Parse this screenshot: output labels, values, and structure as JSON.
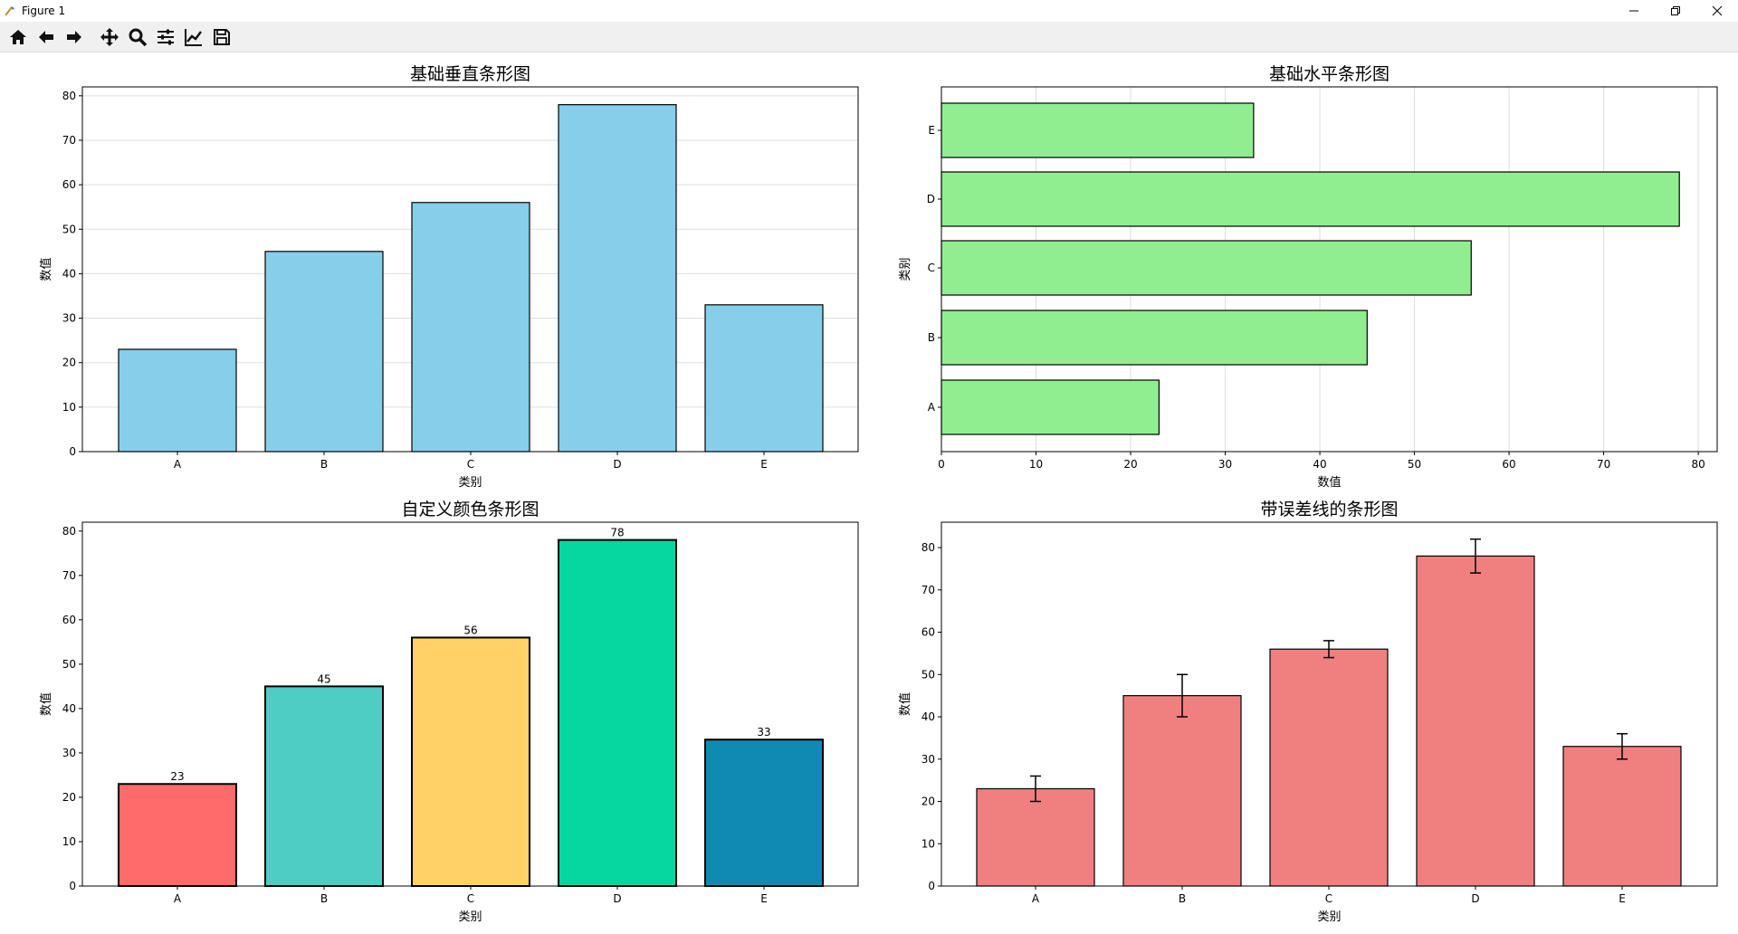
{
  "window": {
    "title": "Figure 1",
    "controls": [
      "minimize",
      "maximize",
      "close"
    ]
  },
  "toolbar": {
    "tools": [
      {
        "name": "home-button",
        "icon": "home-icon"
      },
      {
        "name": "back-button",
        "icon": "arrow-left-icon"
      },
      {
        "name": "forward-button",
        "icon": "arrow-right-icon"
      },
      {
        "name": "pan-button",
        "icon": "move-icon"
      },
      {
        "name": "zoom-button",
        "icon": "magnifier-icon"
      },
      {
        "name": "configure-subplots-button",
        "icon": "sliders-icon"
      },
      {
        "name": "edit-axis-button",
        "icon": "line-chart-icon"
      },
      {
        "name": "save-button",
        "icon": "floppy-disk-icon"
      }
    ]
  },
  "chart_data": [
    {
      "type": "bar",
      "orientation": "vertical",
      "title": "基础垂直条形图",
      "xlabel": "类别",
      "ylabel": "数值",
      "categories": [
        "A",
        "B",
        "C",
        "D",
        "E"
      ],
      "values": [
        23,
        45,
        56,
        78,
        33
      ],
      "ylim": [
        0,
        82
      ],
      "yticks": [
        0,
        10,
        20,
        30,
        40,
        50,
        60,
        70,
        80
      ],
      "grid": "y",
      "colors": [
        "#87ceeb",
        "#87ceeb",
        "#87ceeb",
        "#87ceeb",
        "#87ceeb"
      ],
      "edgecolor": "#000000",
      "data_labels": false
    },
    {
      "type": "bar",
      "orientation": "horizontal",
      "title": "基础水平条形图",
      "xlabel": "数值",
      "ylabel": "类别",
      "categories": [
        "A",
        "B",
        "C",
        "D",
        "E"
      ],
      "values": [
        23,
        45,
        56,
        78,
        33
      ],
      "xlim": [
        0,
        82
      ],
      "xticks": [
        0,
        10,
        20,
        30,
        40,
        50,
        60,
        70,
        80
      ],
      "grid": "x",
      "colors": [
        "#90ee90",
        "#90ee90",
        "#90ee90",
        "#90ee90",
        "#90ee90"
      ],
      "edgecolor": "#000000",
      "data_labels": false
    },
    {
      "type": "bar",
      "orientation": "vertical",
      "title": "自定义颜色条形图",
      "xlabel": "类别",
      "ylabel": "数值",
      "categories": [
        "A",
        "B",
        "C",
        "D",
        "E"
      ],
      "values": [
        23,
        45,
        56,
        78,
        33
      ],
      "ylim": [
        0,
        82
      ],
      "yticks": [
        0,
        10,
        20,
        30,
        40,
        50,
        60,
        70,
        80
      ],
      "grid": "none",
      "colors": [
        "#ff6b6b",
        "#4ecdc4",
        "#ffd166",
        "#06d6a0",
        "#118ab2"
      ],
      "edgecolor": "#000000",
      "data_labels": true
    },
    {
      "type": "bar",
      "orientation": "vertical",
      "title": "带误差线的条形图",
      "xlabel": "类别",
      "ylabel": "数值",
      "categories": [
        "A",
        "B",
        "C",
        "D",
        "E"
      ],
      "values": [
        23,
        45,
        56,
        78,
        33
      ],
      "errors": [
        3,
        5,
        2,
        4,
        3
      ],
      "ylim": [
        0,
        86
      ],
      "yticks": [
        0,
        10,
        20,
        30,
        40,
        50,
        60,
        70,
        80
      ],
      "grid": "none",
      "colors": [
        "#f08080",
        "#f08080",
        "#f08080",
        "#f08080",
        "#f08080"
      ],
      "edgecolor": "#000000",
      "data_labels": false
    }
  ]
}
